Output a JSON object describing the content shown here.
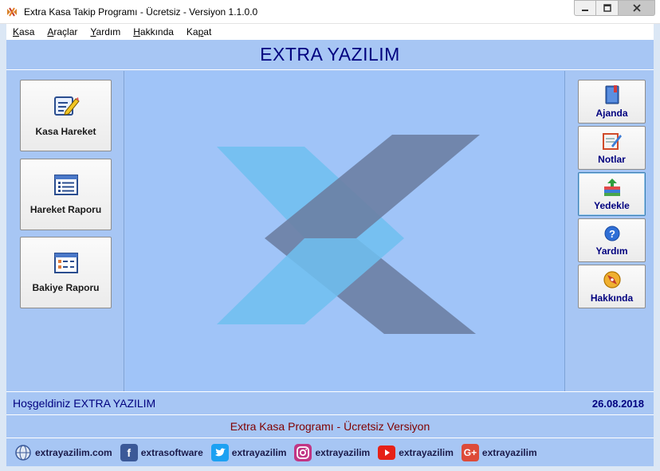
{
  "window": {
    "title": "Extra Kasa Takip Programı - Ücretsiz  - Versiyon 1.1.0.0"
  },
  "menu": [
    {
      "label_u": "K",
      "label_rest": "asa"
    },
    {
      "label_u": "A",
      "label_rest": "raçlar"
    },
    {
      "label_u": "Y",
      "label_rest": "ardım"
    },
    {
      "label_u": "H",
      "label_rest": "akkında"
    },
    {
      "label_pre": "Ka",
      "label_u": "p",
      "label_rest": "at"
    }
  ],
  "header": {
    "title": "EXTRA YAZILIM",
    "title_color": "#00007f"
  },
  "left_buttons": [
    {
      "label": "Kasa Hareket",
      "icon": "edit-document-icon"
    },
    {
      "label": "Hareket Raporu",
      "icon": "list-report-icon"
    },
    {
      "label": "Bakiye Raporu",
      "icon": "balance-report-icon"
    }
  ],
  "right_buttons": [
    {
      "label": "Ajanda",
      "icon": "agenda-book-icon"
    },
    {
      "label": "Notlar",
      "icon": "notes-icon"
    },
    {
      "label": "Yedekle",
      "icon": "backup-icon"
    },
    {
      "label": "Yardım",
      "icon": "help-icon"
    },
    {
      "label": "Hakkında",
      "icon": "about-compass-icon"
    }
  ],
  "status": {
    "welcome": "Hoşgeldiniz EXTRA YAZILIM",
    "date": "26.08.2018"
  },
  "promo": {
    "text": "Extra Kasa Programı - Ücretsiz Versiyon"
  },
  "social": [
    {
      "icon": "globe-icon",
      "text": "extrayazilim.com",
      "color": "#3b5a9a"
    },
    {
      "icon": "facebook-icon",
      "text": "extrasoftware",
      "color": "#3b5998"
    },
    {
      "icon": "twitter-icon",
      "text": "extrayazilim",
      "color": "#1da1f2"
    },
    {
      "icon": "instagram-icon",
      "text": "extrayazilim",
      "color": "#c13584"
    },
    {
      "icon": "youtube-icon",
      "text": "extrayazilim",
      "color": "#e62117"
    },
    {
      "icon": "google-plus-icon",
      "text": "extrayazilim",
      "color": "#dd4b39"
    }
  ],
  "colors": {
    "background": "#a7c6f4",
    "logo_light": "#6fc0f0",
    "logo_dark": "#6b7fa3"
  }
}
